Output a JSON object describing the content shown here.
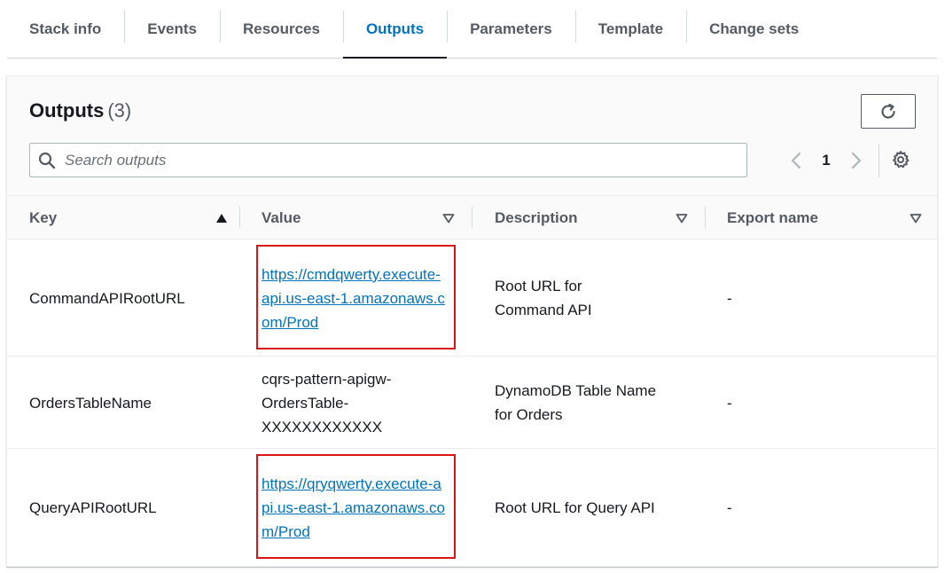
{
  "tabs": [
    {
      "label": "Stack info",
      "active": false
    },
    {
      "label": "Events",
      "active": false
    },
    {
      "label": "Resources",
      "active": false
    },
    {
      "label": "Outputs",
      "active": true
    },
    {
      "label": "Parameters",
      "active": false
    },
    {
      "label": "Template",
      "active": false
    },
    {
      "label": "Change sets",
      "active": false
    }
  ],
  "outputs": {
    "title": "Outputs",
    "count": "(3)",
    "search_placeholder": "Search outputs",
    "page": "1"
  },
  "columns": {
    "key": "Key",
    "value": "Value",
    "description": "Description",
    "export_name": "Export name"
  },
  "rows": [
    {
      "key": "CommandAPIRootURL",
      "value": "https://cmdqwerty.execute-api.us-east-1.amazonaws.com/Prod",
      "description": "Root URL for Command API",
      "export_name": "-"
    },
    {
      "key": "OrdersTableName",
      "value": "cqrs-pattern-apigw-OrdersTable-XXXXXXXXXXXX",
      "description": "DynamoDB Table Name for Orders",
      "export_name": "-"
    },
    {
      "key": "QueryAPIRootURL",
      "value": "https://qryqwerty.execute-api.us-east-1.amazonaws.com/Prod",
      "description": "Root URL for Query API",
      "export_name": "-"
    }
  ],
  "colors": {
    "link": "#0073bb",
    "active_tab": "#0073bb",
    "highlight": "#d91515"
  },
  "icons": [
    "refresh-icon",
    "search-icon",
    "chevron-left-icon",
    "chevron-right-icon",
    "gear-icon",
    "sort-ascending-icon",
    "sort-descending-icon"
  ]
}
